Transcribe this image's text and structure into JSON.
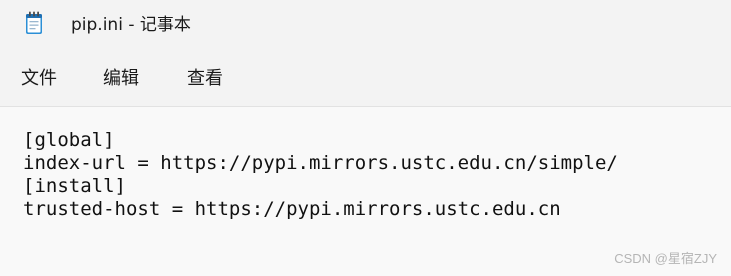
{
  "window": {
    "title": "pip.ini - 记事本",
    "icon": "notepad-icon"
  },
  "menu": {
    "items": [
      {
        "label": "文件"
      },
      {
        "label": "编辑"
      },
      {
        "label": "查看"
      }
    ]
  },
  "editor": {
    "content": "[global]\nindex-url = https://pypi.mirrors.ustc.edu.cn/simple/\n[install]\ntrusted-host = https://pypi.mirrors.ustc.edu.cn"
  },
  "watermark": {
    "text": "CSDN @星宿ZJY"
  },
  "colors": {
    "chrome_background": "#f3f3f3",
    "editor_background": "#f9f9f9",
    "text": "#111111",
    "icon_accent": "#2b8fd6"
  }
}
